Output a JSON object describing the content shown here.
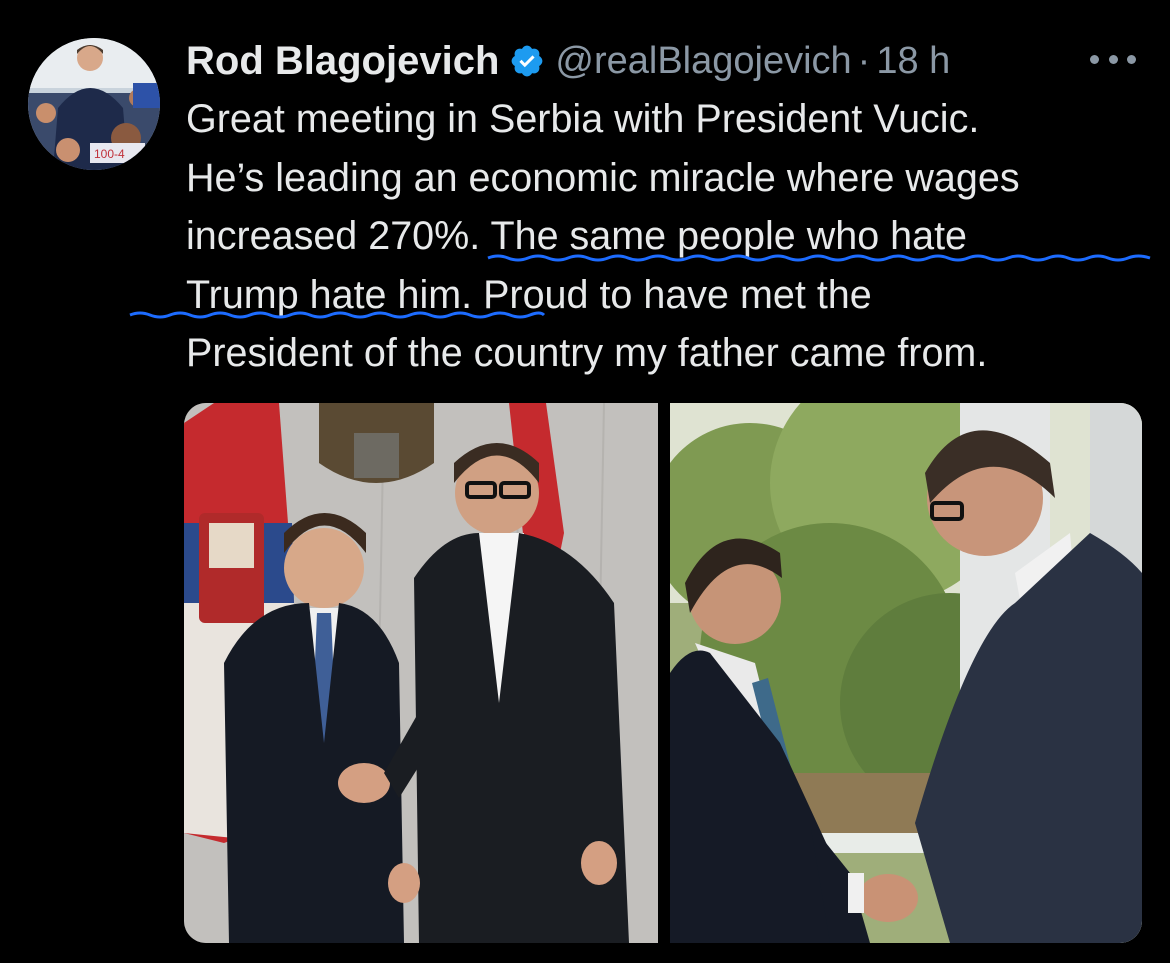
{
  "post": {
    "author": {
      "display_name": "Rod Blagojevich",
      "handle": "@realBlagojevich",
      "verified": true,
      "avatar_icon": "profile-photo"
    },
    "separator": "·",
    "timestamp": "18 h",
    "more_icon": "more-horizontal-icon",
    "text_lines": [
      "Great meeting in Serbia with President Vucic.",
      "He’s leading an economic miracle where wages",
      "increased 270%. The same people who hate",
      "Trump hate him. Proud to have met the",
      "President of the country my father came from."
    ],
    "annotation_color": "#1d6cff",
    "media": [
      {
        "kind": "photo",
        "subject": "handshake in front of Serbian flags and coat of arms"
      },
      {
        "kind": "photo",
        "subject": "handshake near window with trees outside"
      }
    ]
  },
  "theme": {
    "background": "#000000",
    "text": "#e7e9ea",
    "secondary": "#8b98a5",
    "verified_blue": "#1d9bf0"
  }
}
